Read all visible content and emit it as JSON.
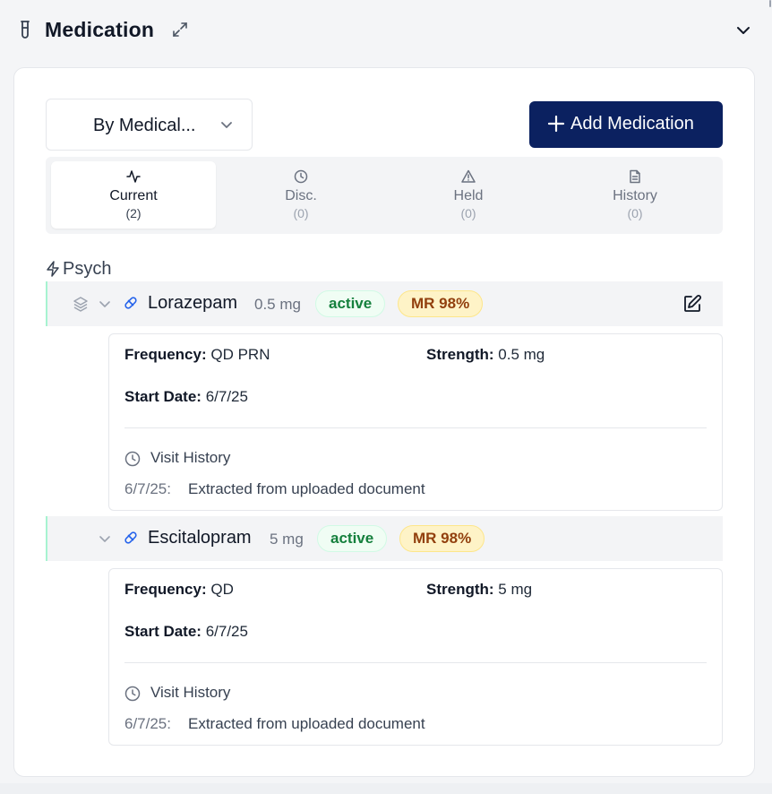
{
  "panel": {
    "title": "Medication",
    "icons": {
      "section": "test-tube-icon",
      "expand": "expand-icon",
      "collapse": "chevron-down-icon"
    }
  },
  "toolbar": {
    "group_by_value": "By Medical...",
    "add_button_label": "Add Medication"
  },
  "tabs": [
    {
      "label": "Current",
      "count": "(2)",
      "icon": "activity-icon",
      "active": true
    },
    {
      "label": "Disc.",
      "count": "(0)",
      "icon": "clock-icon",
      "active": false
    },
    {
      "label": "Held",
      "count": "(0)",
      "icon": "alert-triangle-icon",
      "active": false
    },
    {
      "label": "History",
      "count": "(0)",
      "icon": "file-text-icon",
      "active": false
    }
  ],
  "category": {
    "label": "Psych",
    "icon": "zap-icon"
  },
  "medications": [
    {
      "name": "Lorazepam",
      "dose": "0.5 mg",
      "status": "active",
      "match": "MR 98%",
      "frequency_label": "Frequency:",
      "frequency": "QD PRN",
      "strength_label": "Strength:",
      "strength": "0.5 mg",
      "start_label": "Start Date:",
      "start_date": "6/7/25",
      "visit_history_title": "Visit History",
      "history": [
        {
          "date": "6/7/25:",
          "text": "Extracted from uploaded document"
        }
      ]
    },
    {
      "name": "Escitalopram",
      "dose": "5 mg",
      "status": "active",
      "match": "MR 98%",
      "frequency_label": "Frequency:",
      "frequency": "QD",
      "strength_label": "Strength:",
      "strength": "5 mg",
      "start_label": "Start Date:",
      "start_date": "6/7/25",
      "visit_history_title": "Visit History",
      "history": [
        {
          "date": "6/7/25:",
          "text": "Extracted from uploaded document"
        }
      ]
    }
  ],
  "colors": {
    "primary_button": "#0b2160",
    "active_badge_text": "#15803d",
    "mr_badge_bg": "#fef3c7",
    "mr_badge_text": "#92400e",
    "link_icon": "#2563eb"
  }
}
